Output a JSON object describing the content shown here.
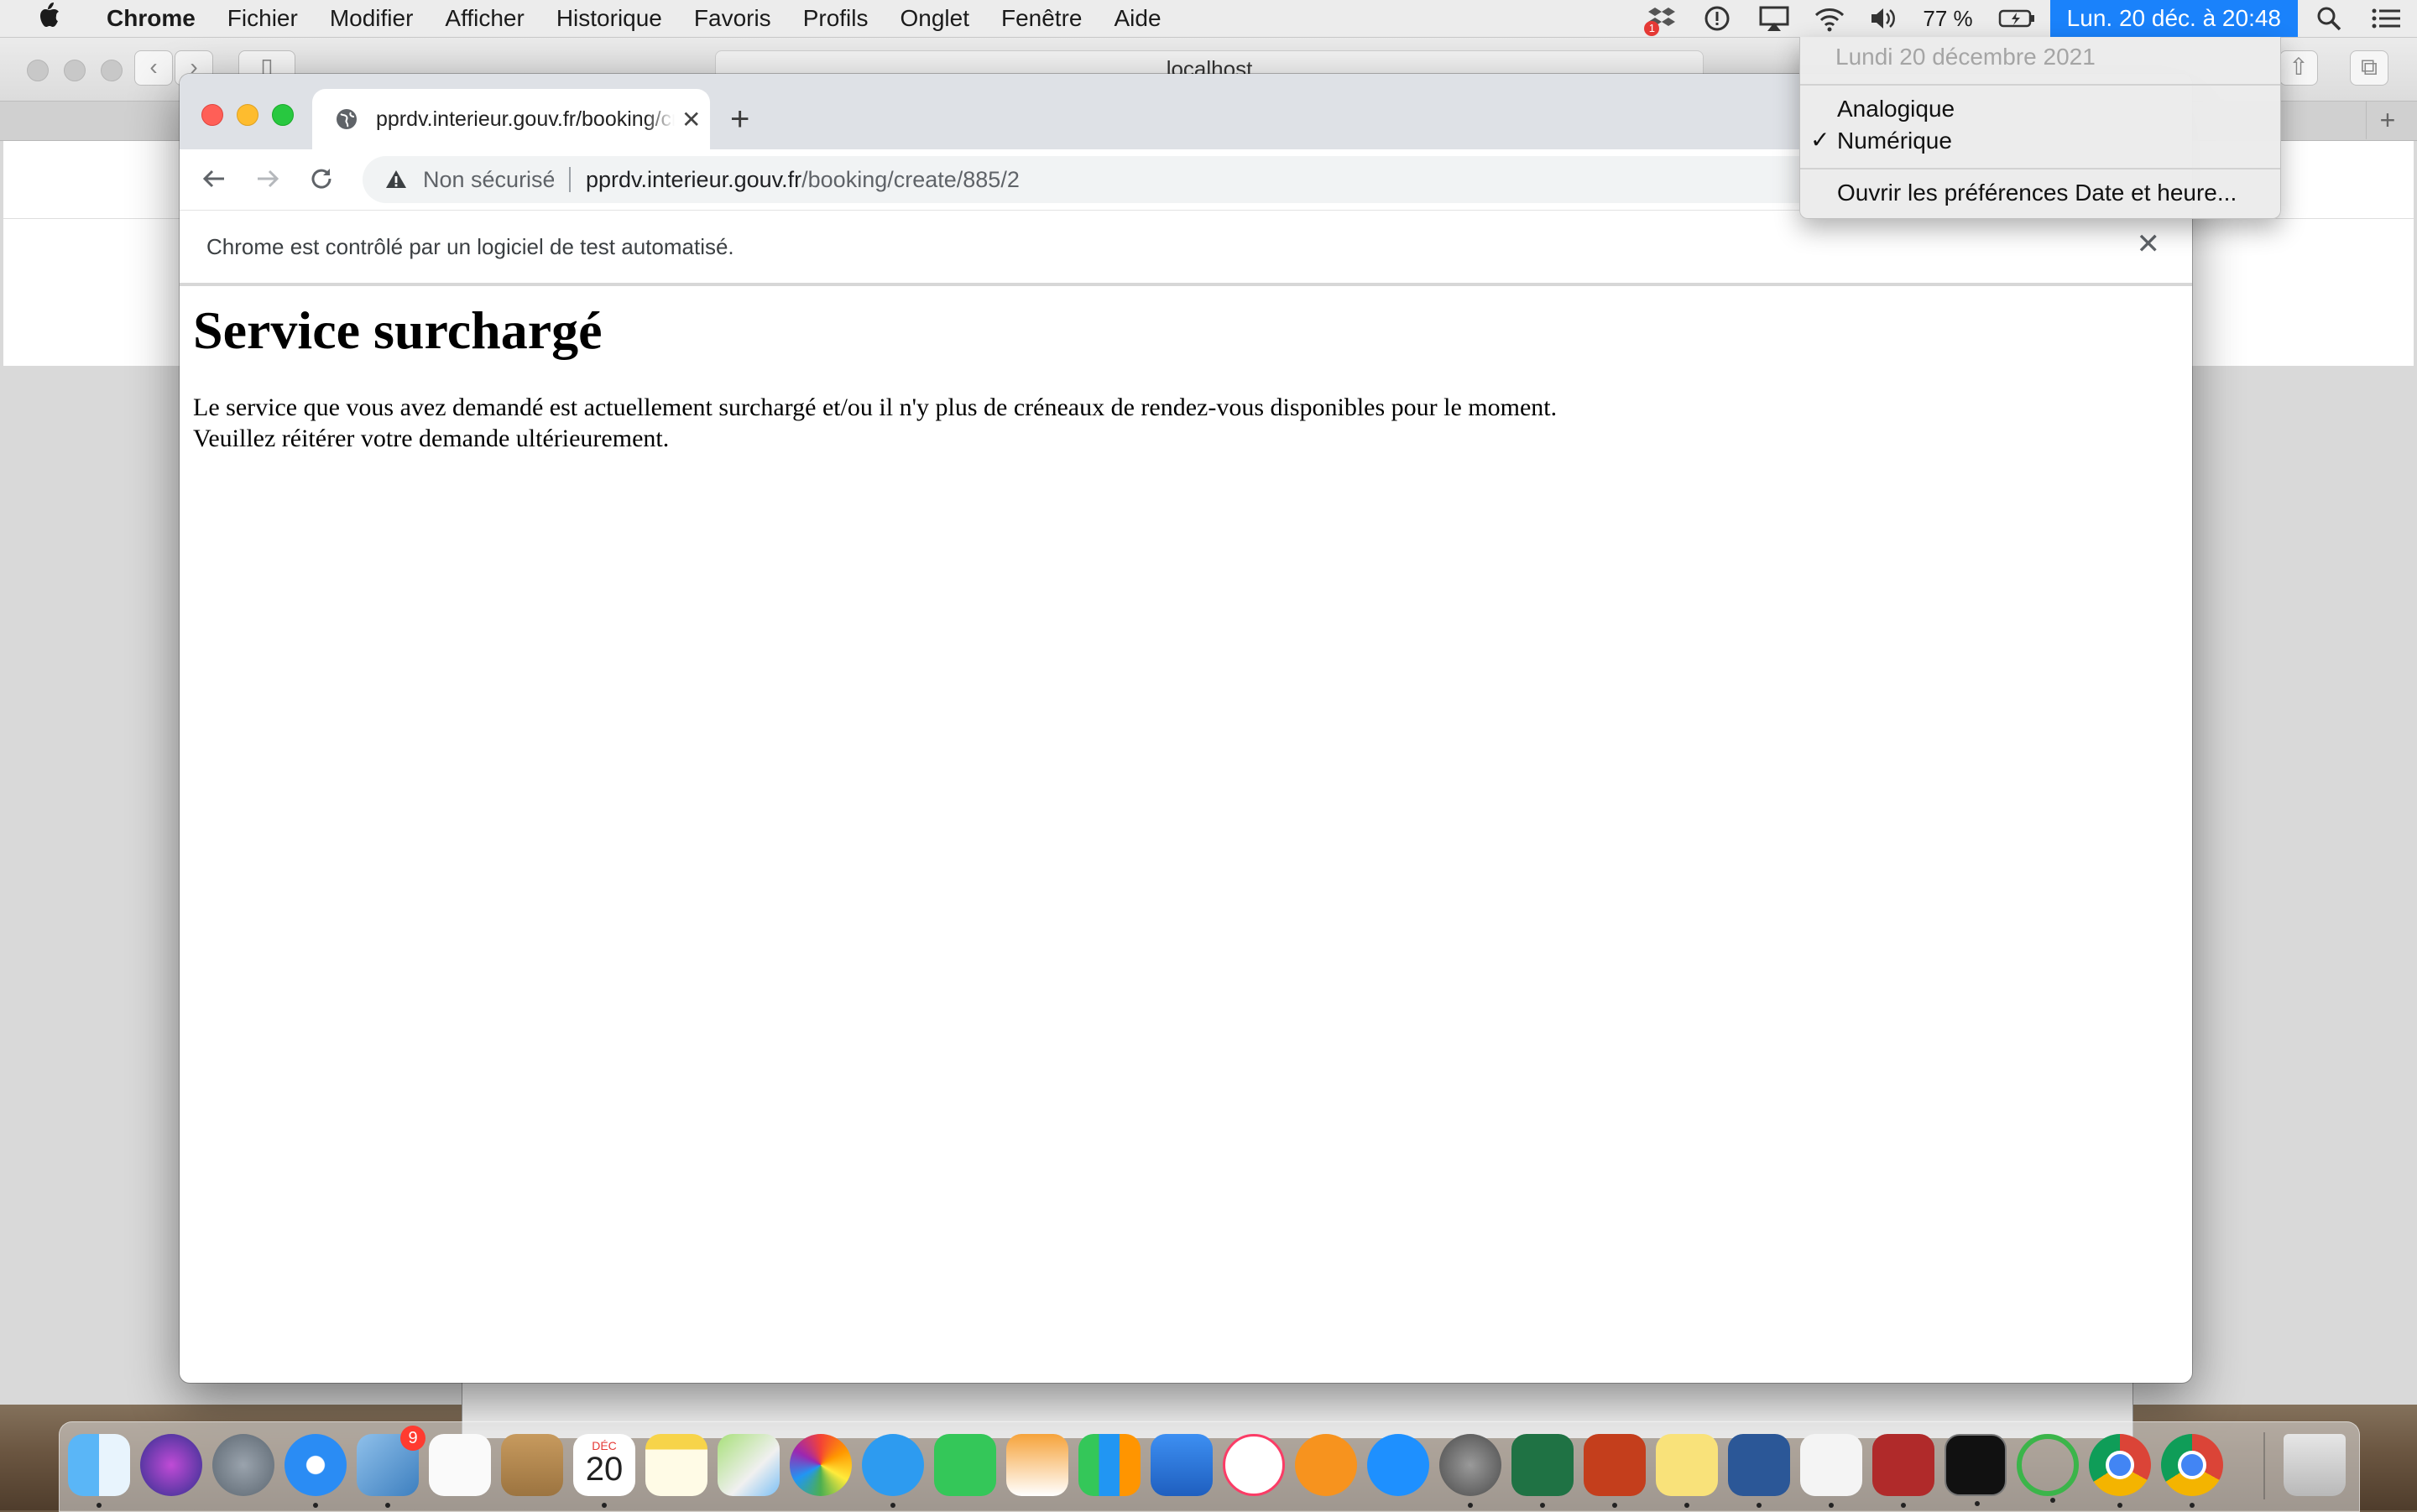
{
  "menubar": {
    "app_name": "Chrome",
    "items": [
      "Fichier",
      "Modifier",
      "Afficher",
      "Historique",
      "Favoris",
      "Profils",
      "Onglet",
      "Fenêtre",
      "Aide"
    ],
    "battery": "77 %",
    "clock": "Lun. 20 déc. à  20:48",
    "dropbox_badge": "1"
  },
  "clock_menu": {
    "date_header": "Lundi 20 décembre 2021",
    "options": [
      "Analogique",
      "Numérique"
    ],
    "selected": "Numérique",
    "preferences": "Ouvrir les préférences Date et heure..."
  },
  "background_window": {
    "address": "localhost"
  },
  "chrome": {
    "tab_title": "pprdv.interieur.gouv.fr/booking/create/885/2",
    "security_label": "Non sécurisé",
    "url_host": "pprdv.interieur.gouv.fr",
    "url_path": "/booking/create/885/2",
    "infobar_message": "Chrome est contrôlé par un logiciel de test automatisé."
  },
  "page": {
    "heading": "Service surchargé",
    "line1": "Le service que vous avez demandé est actuellement surchargé et/ou il n'y plus de créneaux de rendez-vous disponibles pour le moment.",
    "line2": "Veuillez réitérer votre demande ultérieurement."
  },
  "dock": {
    "calendar_month": "DÉC",
    "calendar_day": "20",
    "mail_badge": "9",
    "apps": [
      "finder",
      "siri",
      "launchpad",
      "safari",
      "mail",
      "reminders",
      "contacts",
      "calendar",
      "notes",
      "maps",
      "photos",
      "messages",
      "facetime",
      "pages",
      "numbers",
      "keynote",
      "music",
      "books",
      "app-store",
      "system-preferences",
      "excel",
      "powerpoint",
      "stickies",
      "word",
      "textedit",
      "zotero",
      "terminal",
      "activity",
      "chrome",
      "chrome-2",
      "trash"
    ]
  },
  "colors": {
    "accent": "#1a82fb",
    "traffic_red": "#ff5f57",
    "traffic_yellow": "#febc2e",
    "traffic_green": "#28c840"
  }
}
